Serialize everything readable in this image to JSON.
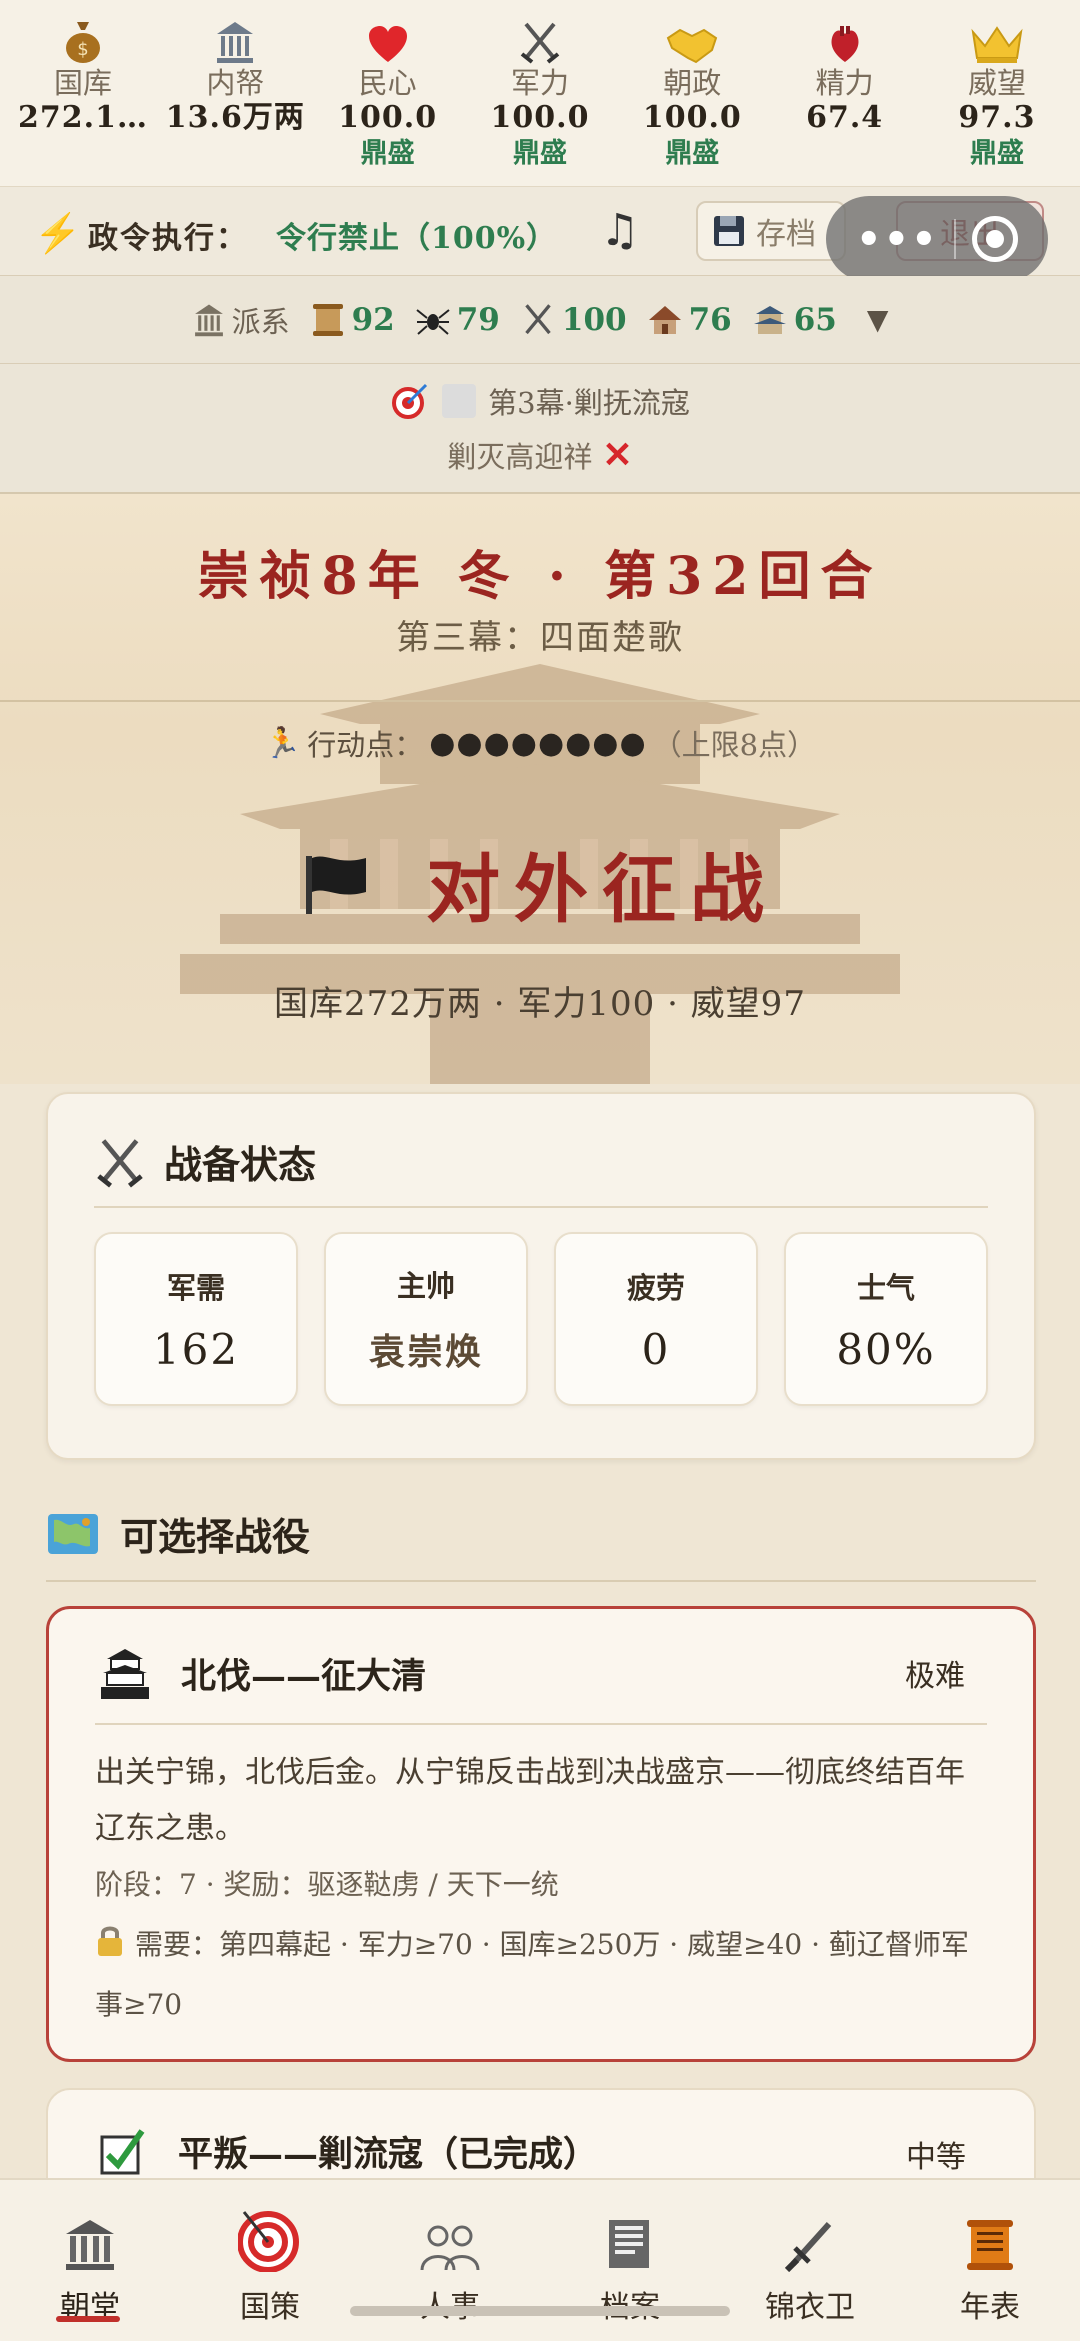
{
  "stats": [
    {
      "name": "treasury",
      "label": "国库",
      "value": "272.1…",
      "status": "",
      "icon": "money-bag-icon"
    },
    {
      "name": "privy-purse",
      "label": "内帑",
      "value": "13.6万两",
      "status": "",
      "icon": "bank-icon"
    },
    {
      "name": "morale",
      "label": "民心",
      "value": "100.0",
      "status": "鼎盛",
      "icon": "heart-icon"
    },
    {
      "name": "military",
      "label": "军力",
      "value": "100.0",
      "status": "鼎盛",
      "icon": "crossed-swords-icon"
    },
    {
      "name": "politics",
      "label": "朝政",
      "value": "100.0",
      "status": "鼎盛",
      "icon": "handshake-icon"
    },
    {
      "name": "energy",
      "label": "精力",
      "value": "67.4",
      "status": "",
      "icon": "anatomical-heart-icon"
    },
    {
      "name": "prestige",
      "label": "威望",
      "value": "97.3",
      "status": "鼎盛",
      "icon": "crown-icon"
    }
  ],
  "decree": {
    "label": "政令执行：",
    "status": "令行禁止（100%）",
    "save_label": "存档",
    "exit_label": "退出"
  },
  "capsule": {
    "dots": "•••"
  },
  "faction": {
    "label": "派系",
    "items": [
      {
        "value": "92",
        "icon": "scroll-icon"
      },
      {
        "value": "79",
        "icon": "spider-icon"
      },
      {
        "value": "100",
        "icon": "crossed-swords-icon"
      },
      {
        "value": "76",
        "icon": "house-icon"
      },
      {
        "value": "65",
        "icon": "castle-icon"
      }
    ]
  },
  "objective": {
    "chapter": "第3幕·剿抚流寇",
    "goal": "剿灭高迎祥"
  },
  "hero": {
    "reign": "崇祯8年 冬 · 第32回合",
    "act": "第三幕：四面楚歌",
    "action_label": "行动点：",
    "action_dots": "●●●●●●●●",
    "action_limit": "（上限8点）",
    "title": "对外征战",
    "summary": "国库272万两 · 军力100 · 威望97"
  },
  "readiness": {
    "title": "战备状态",
    "cells": [
      {
        "label": "军需",
        "value": "162"
      },
      {
        "label": "主帅",
        "value": "袁崇焕"
      },
      {
        "label": "疲劳",
        "value": "0"
      },
      {
        "label": "士气",
        "value": "80%"
      }
    ]
  },
  "battles": {
    "title": "可选择战役",
    "items": [
      {
        "name": "北伐——征大清",
        "difficulty": "极难",
        "desc": "出关宁锦，北伐后金。从宁锦反击战到决战盛京——彻底终结百年辽东之患。",
        "stage": "阶段：7 · 奖励：驱逐鞑虏 / 天下一统",
        "req": "需要：第四幕起 · 军力≥70 · 国库≥250万 · 威望≥40 · 蓟辽督师军事≥70"
      },
      {
        "name": "平叛——剿流寇（已完成）",
        "difficulty": "中等"
      }
    ]
  },
  "nav": [
    {
      "label": "朝堂",
      "icon": "temple-icon"
    },
    {
      "label": "国策",
      "icon": "target-icon"
    },
    {
      "label": "人事",
      "icon": "people-icon"
    },
    {
      "label": "档案",
      "icon": "document-icon"
    },
    {
      "label": "锦衣卫",
      "icon": "dagger-icon"
    },
    {
      "label": "年表",
      "icon": "scroll-icon"
    }
  ],
  "colors": {
    "accent_red": "#9b2520",
    "status_green": "#2e7d4f",
    "background": "#efe6d4"
  }
}
